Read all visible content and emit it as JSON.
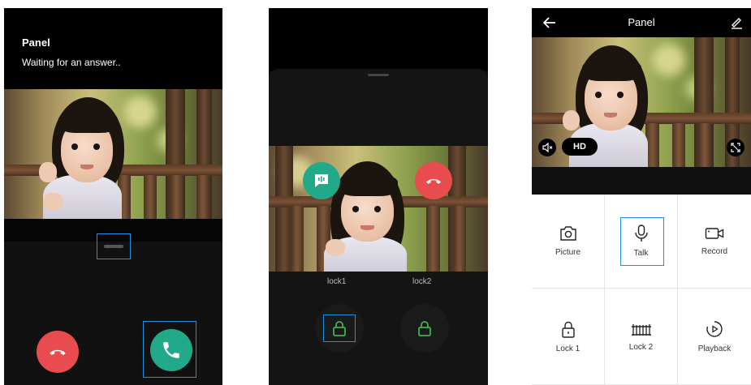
{
  "screen1": {
    "title": "Panel",
    "subtitle": "Waiting for an answer..",
    "icons": [
      "hangup-icon",
      "phone-answer-icon"
    ]
  },
  "screen2": {
    "lock1_label": "lock1",
    "lock2_label": "lock2",
    "icons": [
      "chat-voice-icon",
      "hangup-icon",
      "lock-icon"
    ]
  },
  "screen3": {
    "title": "Panel",
    "quality_label": "HD",
    "actions": [
      {
        "label": "Picture",
        "icon": "camera-icon"
      },
      {
        "label": "Talk",
        "icon": "microphone-icon"
      },
      {
        "label": "Record",
        "icon": "video-camera-icon"
      },
      {
        "label": "Lock 1",
        "icon": "lock-icon"
      },
      {
        "label": "Lock 2",
        "icon": "gate-icon"
      },
      {
        "label": "Playback",
        "icon": "playback-icon"
      }
    ]
  },
  "colors": {
    "accept_green": "#22a98a",
    "hangup_red": "#e84c4f",
    "highlight_blue": "#1e90e0",
    "lock_green": "#3fb34f"
  }
}
